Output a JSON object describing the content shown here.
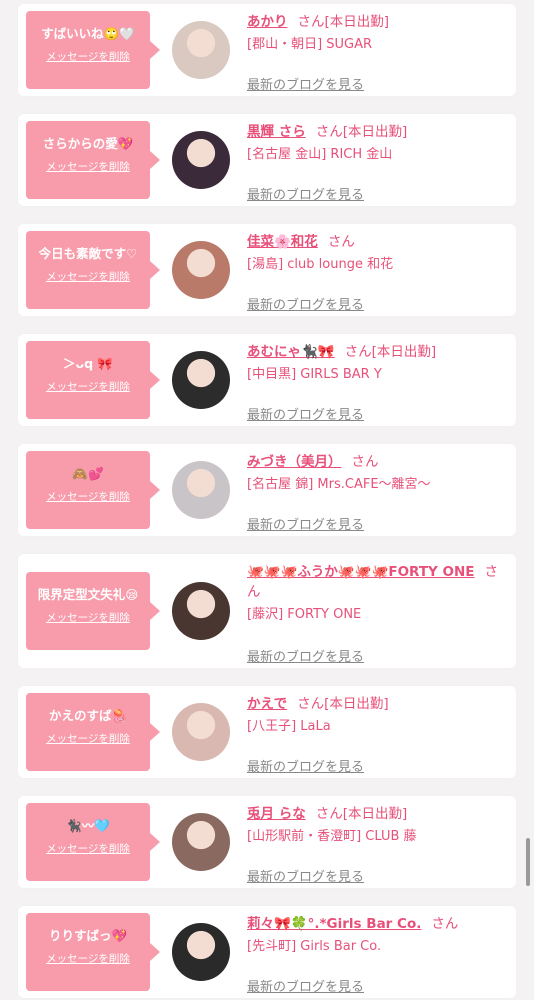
{
  "delete_label": "メッセージを削除",
  "blog_label": "最新のブログを見る",
  "colors": {
    "accent": "#e8507a",
    "bubble": "#f89cac",
    "background": "#f4f2f3"
  },
  "entries": [
    {
      "message": "すばいいね🙄🤍",
      "name": "あかり",
      "suffix": "さん[本日出勤]",
      "shop": "[郡山・朝日] SUGAR",
      "avatar_color": "#d9c9c0"
    },
    {
      "message": "さらからの愛💖",
      "name": "黒輝 さら",
      "suffix": "さん[本日出勤]",
      "shop": "[名古屋 金山] RICH 金山",
      "avatar_color": "#3a2a3a"
    },
    {
      "message": "今日も素敵です♡",
      "name": "佳菜🌸和花",
      "suffix": "さん",
      "shop": "[湯島] club lounge 和花",
      "avatar_color": "#b97a6a"
    },
    {
      "message": "＞ᴗq 🎀",
      "name": "あむにゃ🐈‍⬛🎀",
      "suffix": "さん[本日出勤]",
      "shop": "[中目黒] GIRLS BAR Y",
      "avatar_color": "#2c2c2c"
    },
    {
      "message": "🙈💕",
      "name": "みづき（美月）",
      "suffix": "さん",
      "shop": "[名古屋 錦] Mrs.CAFE〜離宮〜",
      "avatar_color": "#c9c4c8"
    },
    {
      "message": "限界定型文失礼😪",
      "name": "🐙🐙🐙ふうか🐙🐙🐙FORTY ONE",
      "suffix": "さん",
      "shop": "[藤沢] FORTY ONE",
      "avatar_color": "#4a3630"
    },
    {
      "message": "かえのすば🪼",
      "name": "かえで",
      "suffix": "さん[本日出勤]",
      "shop": "[八王子] LaLa",
      "avatar_color": "#d8b8b0"
    },
    {
      "message": "🐈‍⬛〰🩵",
      "name": "兎月 らな",
      "suffix": "さん[本日出勤]",
      "shop": "[山形駅前・香澄町] CLUB 藤",
      "avatar_color": "#8a6a60"
    },
    {
      "message": "りりすばっ💖",
      "name": "莉々🎀🍀°.*Girls Bar Co.",
      "suffix": "さん",
      "shop": "[先斗町] Girls Bar Co.",
      "avatar_color": "#2a2a2a"
    }
  ]
}
